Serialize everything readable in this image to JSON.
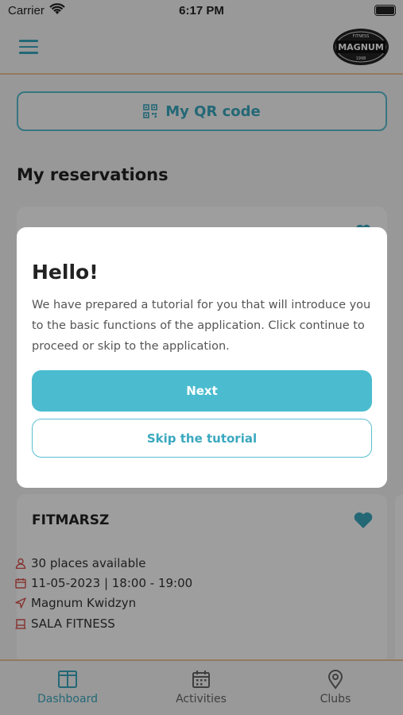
{
  "status_bar": {
    "carrier": "Carrier",
    "time": "6:17 PM"
  },
  "header": {
    "menu_icon": "hamburger-menu-icon",
    "logo_icon": "fitness-magnum-logo"
  },
  "qr_button": {
    "label": "My QR code",
    "icon": "qr-code-icon"
  },
  "reservations": {
    "title": "My reservations",
    "card": {
      "title": "FITMARSZ",
      "favorite_icon": "heart-icon",
      "places": "30 places available",
      "datetime": "11-05-2023 | 18:00 - 19:00",
      "location": "Magnum Kwidzyn",
      "room": "SALA FITNESS"
    }
  },
  "modal": {
    "title": "Hello!",
    "text": "We have prepared a tutorial for you that will introduce you to the basic functions of the application. Click continue to proceed or skip to the application.",
    "next_label": "Next",
    "skip_label": "Skip the tutorial"
  },
  "bottom_nav": {
    "items": [
      {
        "label": "Dashboard",
        "icon": "dashboard-icon",
        "active": true
      },
      {
        "label": "Activities",
        "icon": "calendar-icon",
        "active": false
      },
      {
        "label": "Clubs",
        "icon": "location-pin-icon",
        "active": false
      }
    ]
  },
  "colors": {
    "accent": "#4bbccf",
    "accent_dark": "#3aa8bf",
    "divider": "#f0c39a",
    "icon_red": "#d9534f"
  }
}
